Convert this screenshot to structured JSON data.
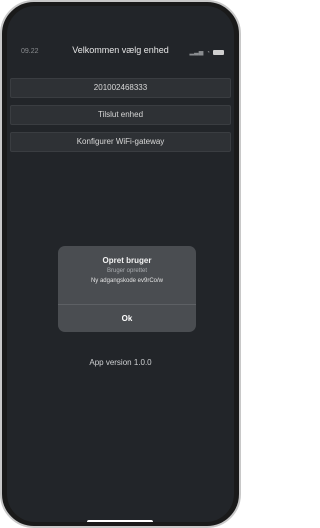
{
  "status_bar": {
    "time": "09.22",
    "location_icon": "location-arrow-icon",
    "signal_icon": "signal-icon",
    "wifi_icon": "wifi-icon",
    "battery_icon": "battery-icon"
  },
  "header": {
    "title": "Velkommen vælg enhed"
  },
  "buttons": [
    {
      "label": "201002468333"
    },
    {
      "label": "Tilslut enhed"
    },
    {
      "label": "Konfigurer WiFi-gateway"
    }
  ],
  "dialog": {
    "title": "Opret bruger",
    "subtitle": "Bruger oprettet",
    "message": "Ny adgangskode ev9rCo/w",
    "ok_label": "Ok"
  },
  "footer": {
    "app_version": "App version 1.0.0"
  }
}
